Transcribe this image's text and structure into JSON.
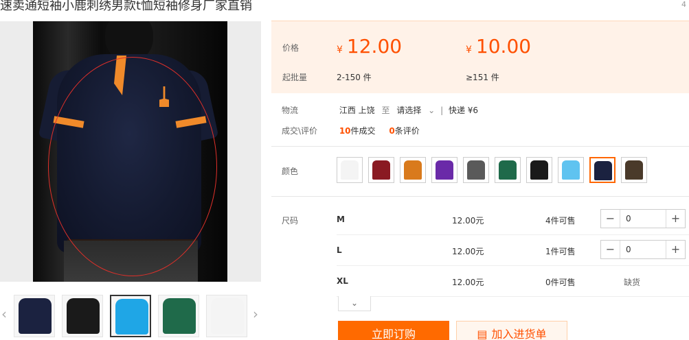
{
  "product": {
    "title": "速卖通短袖小鹿刺绣男款t恤短袖修身厂家直销",
    "page_indicator": "4"
  },
  "pricing": {
    "price_label": "价格",
    "qty_label": "起批量",
    "currency": "¥",
    "tiers": [
      {
        "price": "12.00",
        "qty": "2-150 件"
      },
      {
        "price": "10.00",
        "qty": "≥151 件"
      }
    ]
  },
  "logistics": {
    "label": "物流",
    "from": "江西 上饶",
    "to_word": "至",
    "destination": "请选择",
    "shipping": "快递 ¥6"
  },
  "deal": {
    "label": "成交\\评价",
    "sold_count": "10",
    "sold_suffix": "件成交",
    "review_count": "0",
    "review_suffix": "条评价"
  },
  "color": {
    "label": "颜色",
    "swatches": [
      "#f4f4f4",
      "#8a1a22",
      "#d97a1c",
      "#6a2aa8",
      "#5a5a5a",
      "#1f6a4a",
      "#1a1a1a",
      "#5fc3f0",
      "#1b2240",
      "#4a3a2a"
    ],
    "selected_index": 8
  },
  "sizes": {
    "label": "尺码",
    "items": [
      {
        "name": "M",
        "price": "12.00元",
        "stock": "4件可售",
        "qty": "0"
      },
      {
        "name": "L",
        "price": "12.00元",
        "stock": "1件可售",
        "qty": "0"
      },
      {
        "name": "XL",
        "price": "12.00元",
        "stock": "0件可售",
        "status": "缺货"
      }
    ]
  },
  "actions": {
    "buy_now": "立即订购",
    "add_to_list": "加入进货单"
  },
  "thumbnails": [
    "#1b2240",
    "#1a1a1a",
    "#1fa6e6",
    "#1f6a4a",
    "#f4f4f4"
  ],
  "icons": {
    "prev": "chevron-left-icon",
    "next": "chevron-right-icon",
    "dropdown": "chevron-down-icon",
    "expand": "chevron-down-icon",
    "cart": "clipboard-icon"
  }
}
